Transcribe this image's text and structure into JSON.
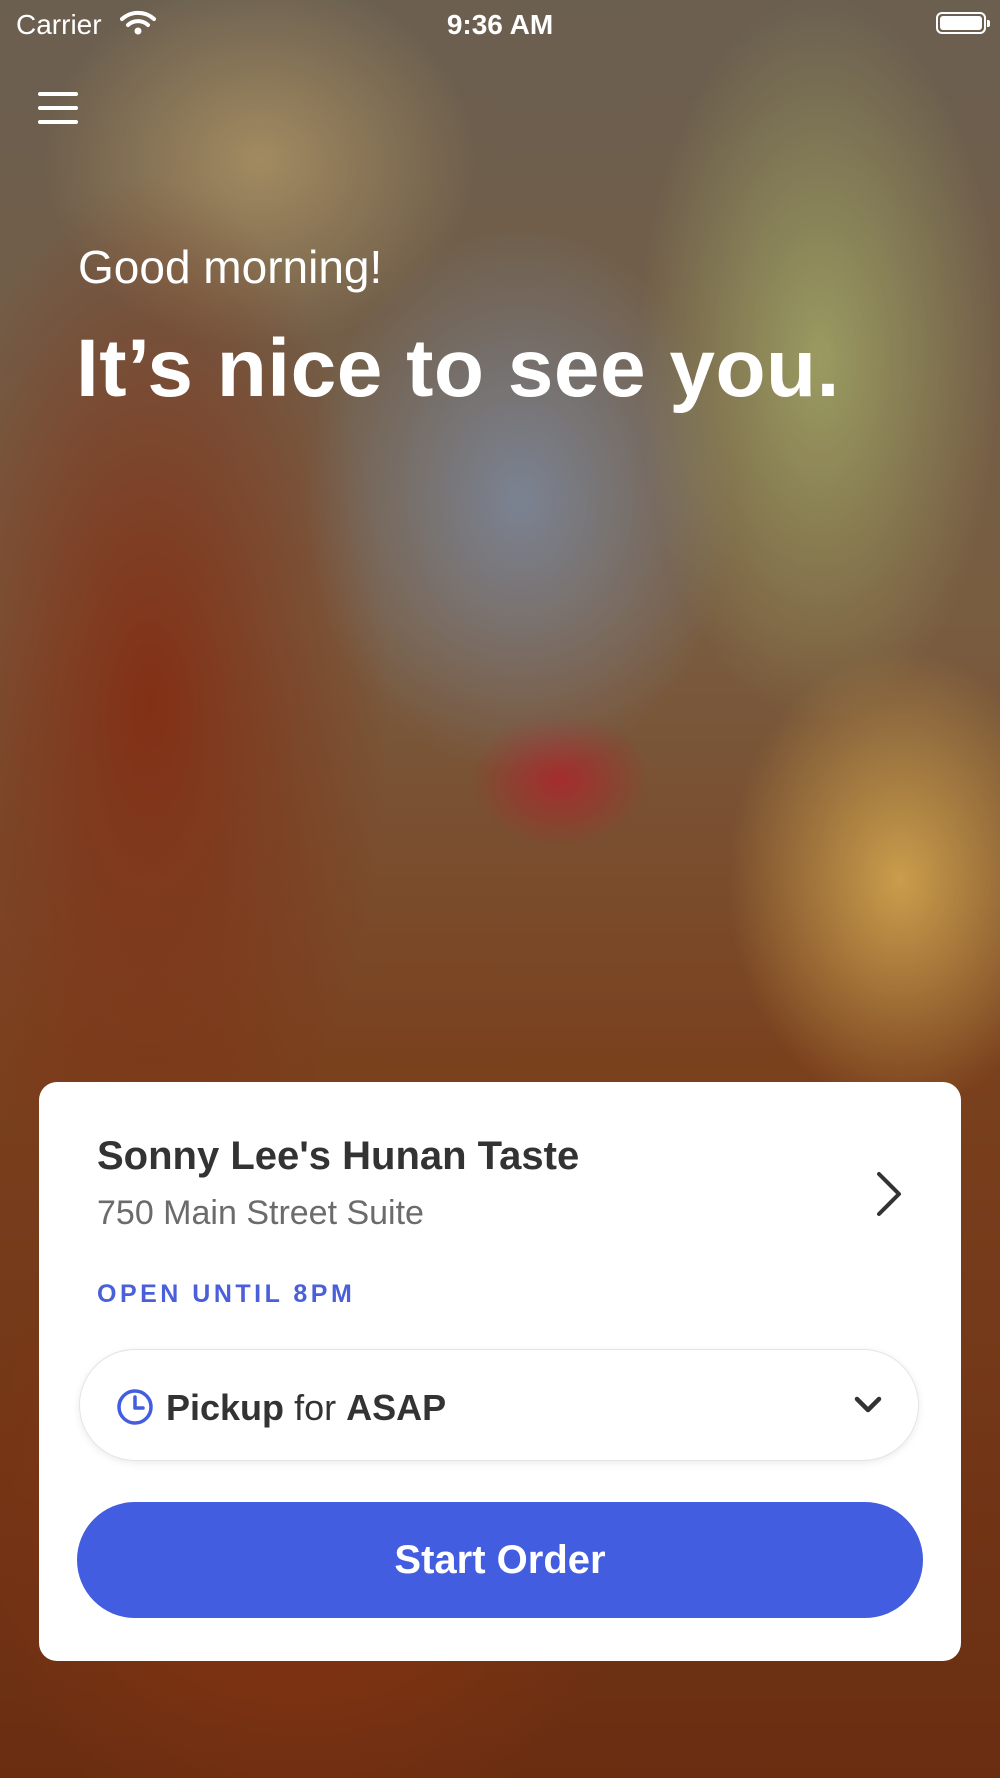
{
  "status_bar": {
    "carrier": "Carrier",
    "time": "9:36 AM"
  },
  "hero": {
    "greeting": "Good morning!",
    "headline": "It’s nice to see you."
  },
  "location_card": {
    "restaurant_name": "Sonny Lee's Hunan Taste",
    "address": "750 Main Street Suite",
    "open_status": "OPEN UNTIL 8PM",
    "order_type": {
      "mode": "Pickup",
      "connector": "for",
      "time": "ASAP"
    },
    "start_button_label": "Start Order"
  },
  "icons": {
    "menu": "hamburger-menu-icon",
    "clock": "clock-icon",
    "chevron_right": "chevron-right-icon",
    "chevron_down": "chevron-down-icon"
  },
  "colors": {
    "accent": "#425ddf",
    "open_status": "#4a5fd9",
    "card_background": "#ffffff"
  }
}
